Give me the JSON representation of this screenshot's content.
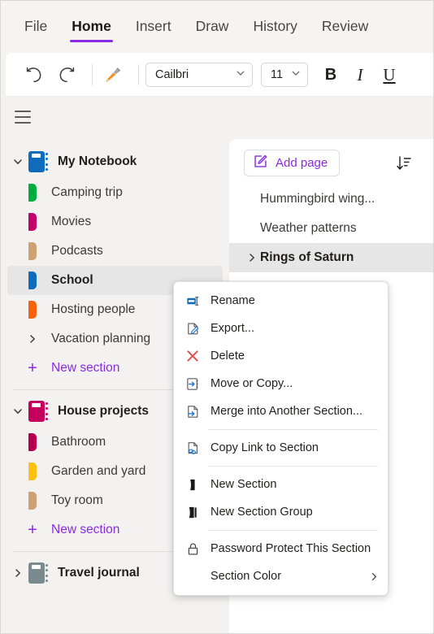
{
  "ribbon": {
    "tabs": [
      {
        "label": "File",
        "active": false
      },
      {
        "label": "Home",
        "active": true
      },
      {
        "label": "Insert",
        "active": false
      },
      {
        "label": "Draw",
        "active": false
      },
      {
        "label": "History",
        "active": false
      },
      {
        "label": "Review",
        "active": false
      }
    ],
    "accent_color": "#8a2be2",
    "undo_icon": "undo-icon",
    "redo_icon": "redo-icon",
    "format_painter_icon": "format-painter-icon",
    "font_name": "Cailbri",
    "font_size": "11",
    "bold_label": "B",
    "italic_label": "I",
    "underline_label": "U"
  },
  "nav": {
    "menu_icon": "hamburger-menu-icon",
    "notebooks": [
      {
        "name": "My Notebook",
        "color": "#0f6cbd",
        "expanded": true,
        "twisty": "chevron-down-icon",
        "sections": [
          {
            "label": "Camping trip",
            "color": "#00ad3e",
            "type": "section",
            "selected": false
          },
          {
            "label": "Movies",
            "color": "#c4006b",
            "type": "section",
            "selected": false
          },
          {
            "label": "Podcasts",
            "color": "#cda172",
            "type": "section",
            "selected": false
          },
          {
            "label": "School",
            "color": "#0f6cbd",
            "type": "section",
            "selected": true
          },
          {
            "label": "Hosting people",
            "color": "#f7630c",
            "type": "section",
            "selected": false
          },
          {
            "label": "Vacation planning",
            "color": "",
            "type": "group",
            "selected": false
          }
        ],
        "new_section_label": "New section"
      },
      {
        "name": "House projects",
        "color": "#c4005e",
        "expanded": true,
        "twisty": "chevron-down-icon",
        "sections": [
          {
            "label": "Bathroom",
            "color": "#b5004f",
            "type": "section",
            "selected": false
          },
          {
            "label": "Garden and yard",
            "color": "#ffc20e",
            "type": "section",
            "selected": false
          },
          {
            "label": "Toy room",
            "color": "#cda172",
            "type": "section",
            "selected": false
          }
        ],
        "new_section_label": "New section"
      },
      {
        "name": "Travel journal",
        "color": "#7a8b8f",
        "expanded": false,
        "twisty": "chevron-right-icon",
        "sections": [],
        "new_section_label": ""
      }
    ]
  },
  "pages": {
    "add_page_label": "Add page",
    "add_page_icon": "edit-page-icon",
    "sort_icon": "sort-descending-icon",
    "items": [
      {
        "title": "Hummingbird wing...",
        "selected": false,
        "has_chevron": false
      },
      {
        "title": "Weather patterns",
        "selected": false,
        "has_chevron": false
      },
      {
        "title": "Rings of Saturn",
        "selected": true,
        "has_chevron": true
      }
    ]
  },
  "context_menu": {
    "items": [
      {
        "label": "Rename",
        "icon": "rename-icon",
        "separator_after": false,
        "submenu": false
      },
      {
        "label": "Export...",
        "icon": "export-icon",
        "separator_after": false,
        "submenu": false
      },
      {
        "label": "Delete",
        "icon": "delete-x-icon",
        "separator_after": false,
        "submenu": false
      },
      {
        "label": "Move or Copy...",
        "icon": "move-or-copy-icon",
        "separator_after": false,
        "submenu": false
      },
      {
        "label": "Merge into Another Section...",
        "icon": "merge-section-icon",
        "separator_after": true,
        "submenu": false
      },
      {
        "label": "Copy Link to Section",
        "icon": "copy-link-icon",
        "separator_after": true,
        "submenu": false
      },
      {
        "label": "New Section",
        "icon": "new-section-icon",
        "separator_after": false,
        "submenu": false
      },
      {
        "label": "New Section Group",
        "icon": "new-section-group-icon",
        "separator_after": true,
        "submenu": false
      },
      {
        "label": "Password Protect This Section",
        "icon": "lock-icon",
        "separator_after": false,
        "submenu": false
      },
      {
        "label": "Section Color",
        "icon": "",
        "separator_after": false,
        "submenu": true
      }
    ]
  }
}
